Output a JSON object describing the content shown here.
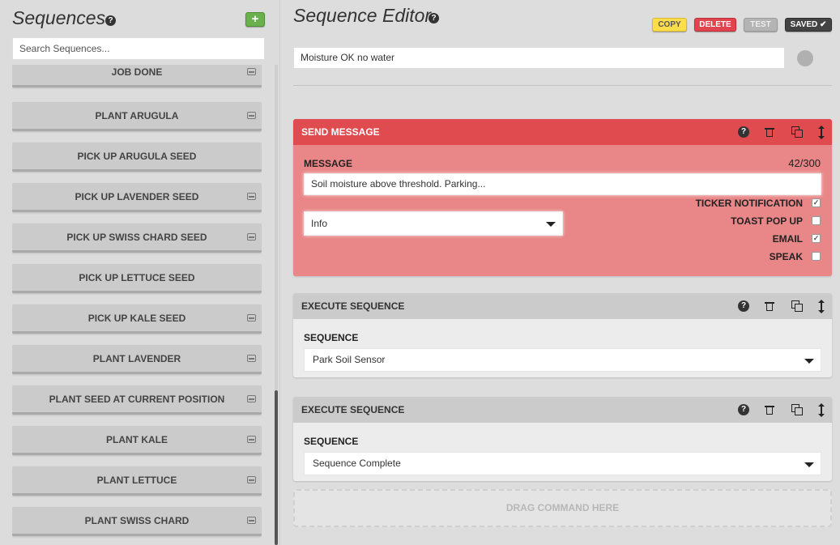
{
  "sidebar": {
    "title": "Sequences",
    "help_icon": "?",
    "add_label": "+",
    "search": {
      "placeholder": "Search Sequences...",
      "value": ""
    },
    "items": [
      {
        "label": "JOB DONE",
        "icon": "disk-icon"
      },
      {
        "label": "PLANT ARUGULA",
        "icon": "disk-icon"
      },
      {
        "label": "PICK UP ARUGULA SEED",
        "icon": ""
      },
      {
        "label": "PICK UP LAVENDER SEED",
        "icon": "disk-icon"
      },
      {
        "label": "PICK UP SWISS CHARD SEED",
        "icon": "disk-icon"
      },
      {
        "label": "PICK UP LETTUCE SEED",
        "icon": ""
      },
      {
        "label": "PICK UP KALE SEED",
        "icon": "disk-icon"
      },
      {
        "label": "PLANT LAVENDER",
        "icon": "disk-icon"
      },
      {
        "label": "PLANT SEED AT CURRENT POSITION",
        "icon": "disk-icon"
      },
      {
        "label": "PLANT KALE",
        "icon": "disk-icon"
      },
      {
        "label": "PLANT LETTUCE",
        "icon": "disk-icon"
      },
      {
        "label": "PLANT SWISS CHARD",
        "icon": "disk-icon"
      }
    ]
  },
  "editor": {
    "title": "Sequence Editor",
    "help_icon": "?",
    "buttons": {
      "copy": "COPY",
      "delete": "DELETE",
      "test": "TEST",
      "saved": "SAVED ✔"
    },
    "sequence_name": "Moisture OK no water",
    "steps": {
      "send_message": {
        "title": "SEND MESSAGE",
        "message_label": "MESSAGE",
        "char_count": "42/300",
        "message_value": "Soil moisture above threshold.  Parking...",
        "type_value": "Info",
        "channels": [
          {
            "label": "TICKER NOTIFICATION",
            "checked": "✓"
          },
          {
            "label": "TOAST POP UP",
            "checked": ""
          },
          {
            "label": "EMAIL",
            "checked": "✓"
          },
          {
            "label": "SPEAK",
            "checked": ""
          }
        ]
      },
      "execute_1": {
        "title": "EXECUTE SEQUENCE",
        "sequence_label": "SEQUENCE",
        "sequence_value": "Park Soil Sensor"
      },
      "execute_2": {
        "title": "EXECUTE SEQUENCE",
        "sequence_label": "SEQUENCE",
        "sequence_value": "Sequence Complete"
      }
    },
    "drop_zone": "DRAG COMMAND HERE"
  },
  "colors": {
    "send_message_header": "#e04b50",
    "send_message_body": "#e98687",
    "copy_button": "#fddd4a",
    "delete_button": "#e1444e",
    "test_button": "#b4b4b4",
    "saved_button": "#434343",
    "add_button": "#6ab04c"
  }
}
